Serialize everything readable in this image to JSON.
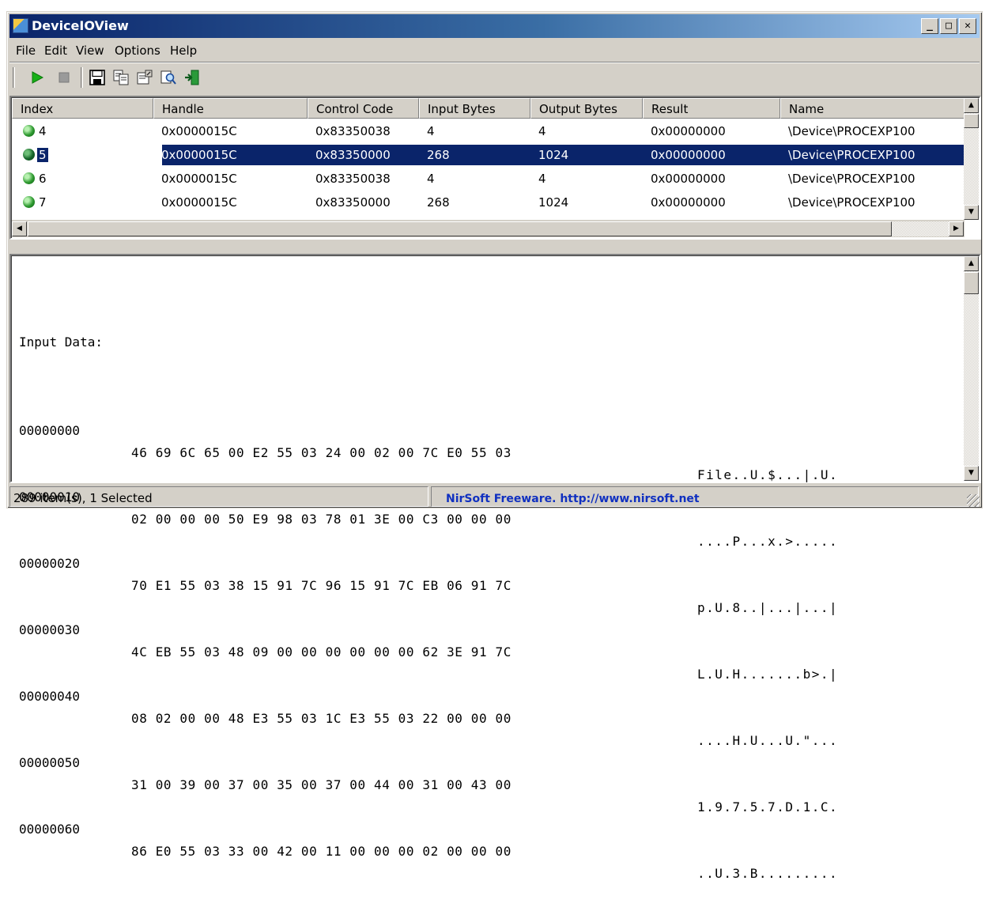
{
  "window": {
    "title": "DeviceIOView"
  },
  "menu": [
    {
      "label": "File"
    },
    {
      "label": "Edit"
    },
    {
      "label": "View"
    },
    {
      "label": "Options"
    },
    {
      "label": "Help"
    }
  ],
  "toolbar": {
    "icons": [
      "play-icon",
      "stop-icon",
      "save-icon",
      "copy-icon",
      "properties-icon",
      "find-icon",
      "exit-icon"
    ]
  },
  "list": {
    "columns": [
      "Index",
      "Handle",
      "Control Code",
      "Input Bytes",
      "Output Bytes",
      "Result",
      "Name"
    ],
    "rows": [
      {
        "index": "4",
        "handle": "0x0000015C",
        "control_code": "0x83350038",
        "input_bytes": "4",
        "output_bytes": "4",
        "result": "0x00000000",
        "name": "\\Device\\PROCEXP100"
      },
      {
        "index": "5",
        "handle": "0x0000015C",
        "control_code": "0x83350000",
        "input_bytes": "268",
        "output_bytes": "1024",
        "result": "0x00000000",
        "name": "\\Device\\PROCEXP100"
      },
      {
        "index": "6",
        "handle": "0x0000015C",
        "control_code": "0x83350038",
        "input_bytes": "4",
        "output_bytes": "4",
        "result": "0x00000000",
        "name": "\\Device\\PROCEXP100"
      },
      {
        "index": "7",
        "handle": "0x0000015C",
        "control_code": "0x83350000",
        "input_bytes": "268",
        "output_bytes": "1024",
        "result": "0x00000000",
        "name": "\\Device\\PROCEXP100"
      }
    ],
    "selected_index": "5"
  },
  "data_pane": {
    "heading": "Input Data:",
    "lines": [
      {
        "offset": "00000000",
        "bytes": "46 69 6C 65 00 E2 55 03 24 00 02 00 7C E0 55 03",
        "ascii": "File..U.$...|.U."
      },
      {
        "offset": "00000010",
        "bytes": "02 00 00 00 50 E9 98 03 78 01 3E 00 C3 00 00 00",
        "ascii": "....P...x.>....."
      },
      {
        "offset": "00000020",
        "bytes": "70 E1 55 03 38 15 91 7C 96 15 91 7C EB 06 91 7C",
        "ascii": "p.U.8..|...|...|"
      },
      {
        "offset": "00000030",
        "bytes": "4C EB 55 03 48 09 00 00 00 00 00 00 62 3E 91 7C",
        "ascii": "L.U.H.......b>.|"
      },
      {
        "offset": "00000040",
        "bytes": "08 02 00 00 48 E3 55 03 1C E3 55 03 22 00 00 00",
        "ascii": "....H.U...U.\"..."
      },
      {
        "offset": "00000050",
        "bytes": "31 00 39 00 37 00 35 00 37 00 44 00 31 00 43 00",
        "ascii": "1.9.7.5.7.D.1.C."
      },
      {
        "offset": "00000060",
        "bytes": "86 E0 55 03 33 00 42 00 11 00 00 00 02 00 00 00",
        "ascii": "..U.3.B........."
      }
    ]
  },
  "status": {
    "items": "289 item(s), 1 Selected",
    "link": "NirSoft Freeware.  http://www.nirsoft.net"
  },
  "colors": {
    "selection": "#0a246a",
    "link": "#1030c0",
    "face": "#d4d0c8"
  }
}
